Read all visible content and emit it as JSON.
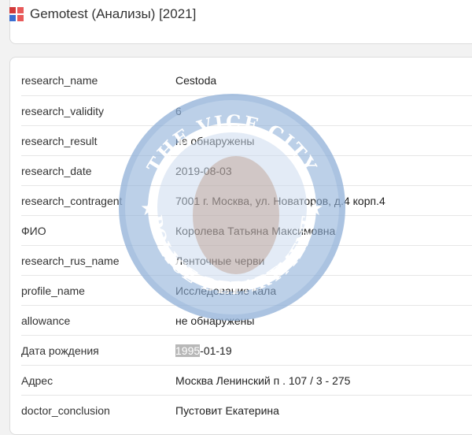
{
  "window": {
    "icon": "grid-app-icon",
    "title": "Gemotest (Анализы) [2021]"
  },
  "records": [
    {
      "key": "research_name",
      "value": "Cestoda"
    },
    {
      "key": "research_validity",
      "value": "6"
    },
    {
      "key": "research_result",
      "value": "не обнаружены"
    },
    {
      "key": "research_date",
      "value": "2019-08-03"
    },
    {
      "key": "research_contragent",
      "value": "7001 г. Москва, ул. Новаторов, д.4 корп.4"
    },
    {
      "key": "ФИО",
      "value": "Королева Татьяна Максимовна"
    },
    {
      "key": "research_rus_name",
      "value": "Ленточные черви"
    },
    {
      "key": "profile_name",
      "value": "Исследование кала"
    },
    {
      "key": "allowance",
      "value": "не обнаружены"
    },
    {
      "key": "Дата рождения",
      "value_selected": "1995",
      "value_rest": "-01-19"
    },
    {
      "key": "Адрес",
      "value": "Москва Ленинский п . 107 / 3 - 275"
    },
    {
      "key": "doctor_conclusion",
      "value": "Пустовит Екатерина"
    }
  ],
  "watermark": {
    "top_text": "THE VICE CITY",
    "bottom_text": "POLICE DEPARTMENT",
    "ring_color": "#8fb0d8",
    "inner_color": "#c9d8ec"
  }
}
